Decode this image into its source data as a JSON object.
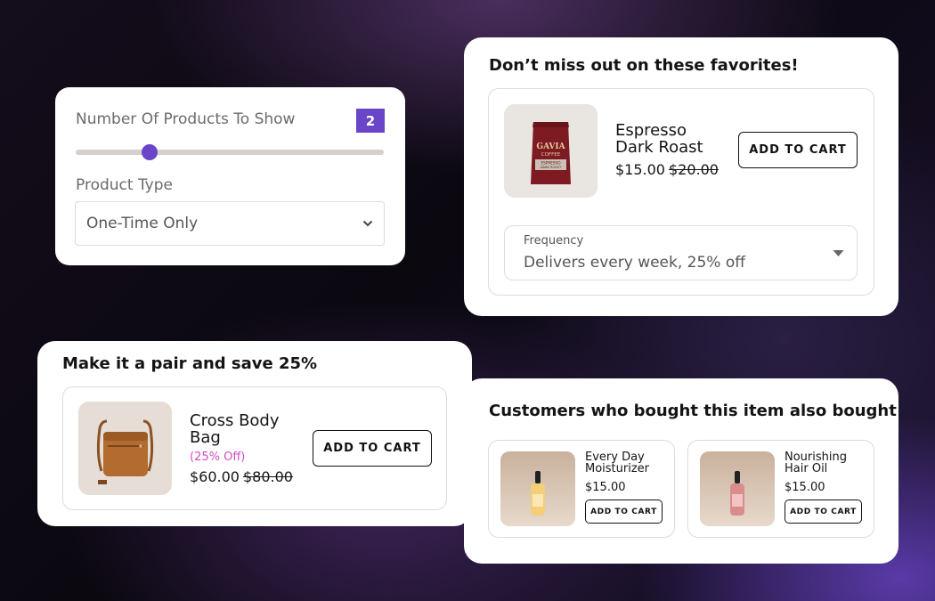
{
  "settings": {
    "count_label": "Number Of Products To Show",
    "count_value": "2",
    "slider_fraction": 0.24,
    "type_label": "Product Type",
    "type_value": "One-Time Only"
  },
  "favorites": {
    "title": "Don’t miss out on these favorites!",
    "product": {
      "name_line1": "Espresso",
      "name_line2": "Dark Roast",
      "price": "$15.00",
      "old_price": "$20.00",
      "image_brand": "GAVIA",
      "image_sub": "COFFEE",
      "image_tag_line1": "ESPRESSO",
      "image_tag_line2": "DARK ROAST"
    },
    "add_to_cart": "ADD TO CART",
    "frequency_label": "Frequency",
    "frequency_value": "Delivers every week, 25% off"
  },
  "pair": {
    "title": "Make it a pair and save 25%",
    "product": {
      "name_line1": "Cross Body",
      "name_line2": "Bag",
      "discount": "(25% Off)",
      "price": "$60.00",
      "old_price": "$80.00"
    },
    "add_to_cart": "ADD TO CART"
  },
  "also": {
    "title": "Customers who bought this item also bought",
    "items": [
      {
        "name_line1": "Every Day",
        "name_line2": "Moisturizer",
        "price": "$15.00",
        "add_to_cart": "ADD TO CART"
      },
      {
        "name_line1": "Nourishing",
        "name_line2": "Hair Oil",
        "price": "$15.00",
        "add_to_cart": "ADD TO CART"
      }
    ]
  },
  "colors": {
    "accent": "#6a45c8",
    "discount": "#d24bc7"
  },
  "icons": [
    "chevron-down-icon",
    "caret-down-icon"
  ]
}
